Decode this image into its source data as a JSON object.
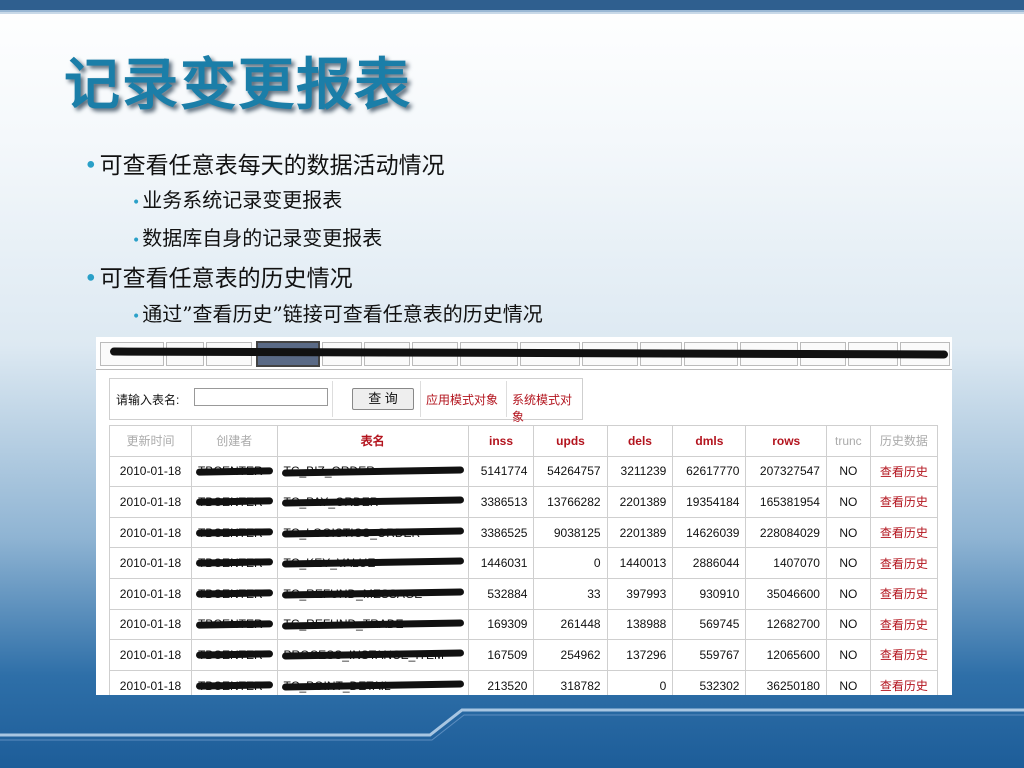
{
  "slide": {
    "title": "记录变更报表",
    "bullets": [
      {
        "text": "可查看任意表每天的数据活动情况"
      },
      {
        "text": "业务系统记录变更报表"
      },
      {
        "text": "数据库自身的记录变更报表"
      },
      {
        "text": "可查看任意表的历史情况"
      },
      {
        "text": "通过”查看历史”链接可查看任意表的历史情况"
      }
    ],
    "bullet_color": "#2aa0c8",
    "title_color": "#1b7ea8"
  },
  "screenshot": {
    "search": {
      "label": "请输入表名:",
      "value": "",
      "button": "查 询",
      "link_app": "应用模式对象",
      "link_sys": "系统模式对象"
    },
    "table": {
      "columns": [
        "更新时间",
        "创建者",
        "表名",
        "inss",
        "upds",
        "dels",
        "dmls",
        "rows",
        "trunc",
        "历史数据"
      ],
      "rows": [
        {
          "date": "2010-01-18",
          "owner": "TBCENTER",
          "table": "TC_BIZ_ORDER",
          "inss": "5141774",
          "upds": "54264757",
          "dels": "3211239",
          "dmls": "62617770",
          "rows": "207327547",
          "trunc": "NO",
          "hist": "查看历史"
        },
        {
          "date": "2010-01-18",
          "owner": "TBCENTER",
          "table": "TC_PAY_ORDER",
          "inss": "3386513",
          "upds": "13766282",
          "dels": "2201389",
          "dmls": "19354184",
          "rows": "165381954",
          "trunc": "NO",
          "hist": "查看历史"
        },
        {
          "date": "2010-01-18",
          "owner": "TBCENTER",
          "table": "TC_LOGISTICS_ORDER",
          "inss": "3386525",
          "upds": "9038125",
          "dels": "2201389",
          "dmls": "14626039",
          "rows": "228084029",
          "trunc": "NO",
          "hist": "查看历史"
        },
        {
          "date": "2010-01-18",
          "owner": "TBCENTER",
          "table": "TC_KEY_VALUE",
          "inss": "1446031",
          "upds": "0",
          "dels": "1440013",
          "dmls": "2886044",
          "rows": "1407070",
          "trunc": "NO",
          "hist": "查看历史"
        },
        {
          "date": "2010-01-18",
          "owner": "TBCENTER",
          "table": "TC_REFUND_MESSAGE",
          "inss": "532884",
          "upds": "33",
          "dels": "397993",
          "dmls": "930910",
          "rows": "35046600",
          "trunc": "NO",
          "hist": "查看历史"
        },
        {
          "date": "2010-01-18",
          "owner": "TBCENTER",
          "table": "TC_REFUND_TRADE",
          "inss": "169309",
          "upds": "261448",
          "dels": "138988",
          "dmls": "569745",
          "rows": "12682700",
          "trunc": "NO",
          "hist": "查看历史"
        },
        {
          "date": "2010-01-18",
          "owner": "TBCENTER",
          "table": "PROCESS_INSTANCE_ITEM",
          "inss": "167509",
          "upds": "254962",
          "dels": "137296",
          "dmls": "559767",
          "rows": "12065600",
          "trunc": "NO",
          "hist": "查看历史"
        },
        {
          "date": "2010-01-18",
          "owner": "TBCENTER",
          "table": "TC_POINT_DETAIL",
          "inss": "213520",
          "upds": "318782",
          "dels": "0",
          "dmls": "532302",
          "rows": "36250180",
          "trunc": "NO",
          "hist": "查看历史"
        }
      ]
    }
  }
}
